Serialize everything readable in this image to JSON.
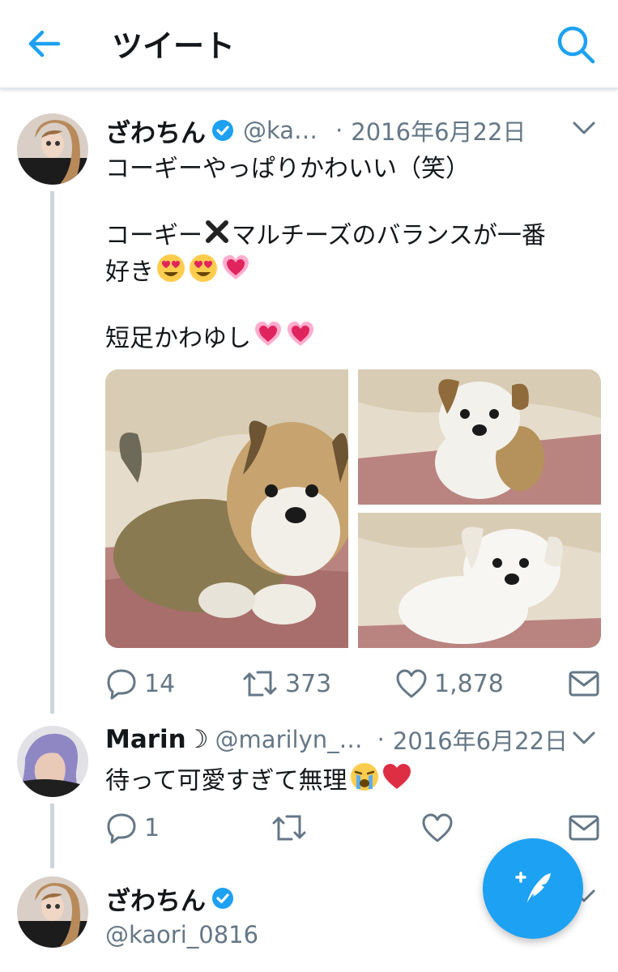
{
  "header": {
    "title": "ツイート"
  },
  "tweet1": {
    "name": "ざわちん",
    "handle": "@ka…",
    "dot": "·",
    "date": "2016年6月22日",
    "line1": "コーギーやっぱりかわいい（笑）",
    "line2a": "コーギー",
    "line2b": "マルチーズのバランスが一番",
    "line3": "好き",
    "line4": "短足かわゆし",
    "replies": "14",
    "retweets": "373",
    "likes": "1,878"
  },
  "tweet2": {
    "name": "Marin☽",
    "handle": "@marilyn_…",
    "dot": "·",
    "date": "2016年6月22日",
    "text": "待って可愛すぎて無理",
    "replies": "1"
  },
  "tweet3": {
    "name": "ざわちん",
    "handle": "@kaori_0816"
  },
  "colors": {
    "accent": "#1da1f2",
    "text": "#14171a",
    "muted": "#657786",
    "line": "#ccd6dd"
  }
}
